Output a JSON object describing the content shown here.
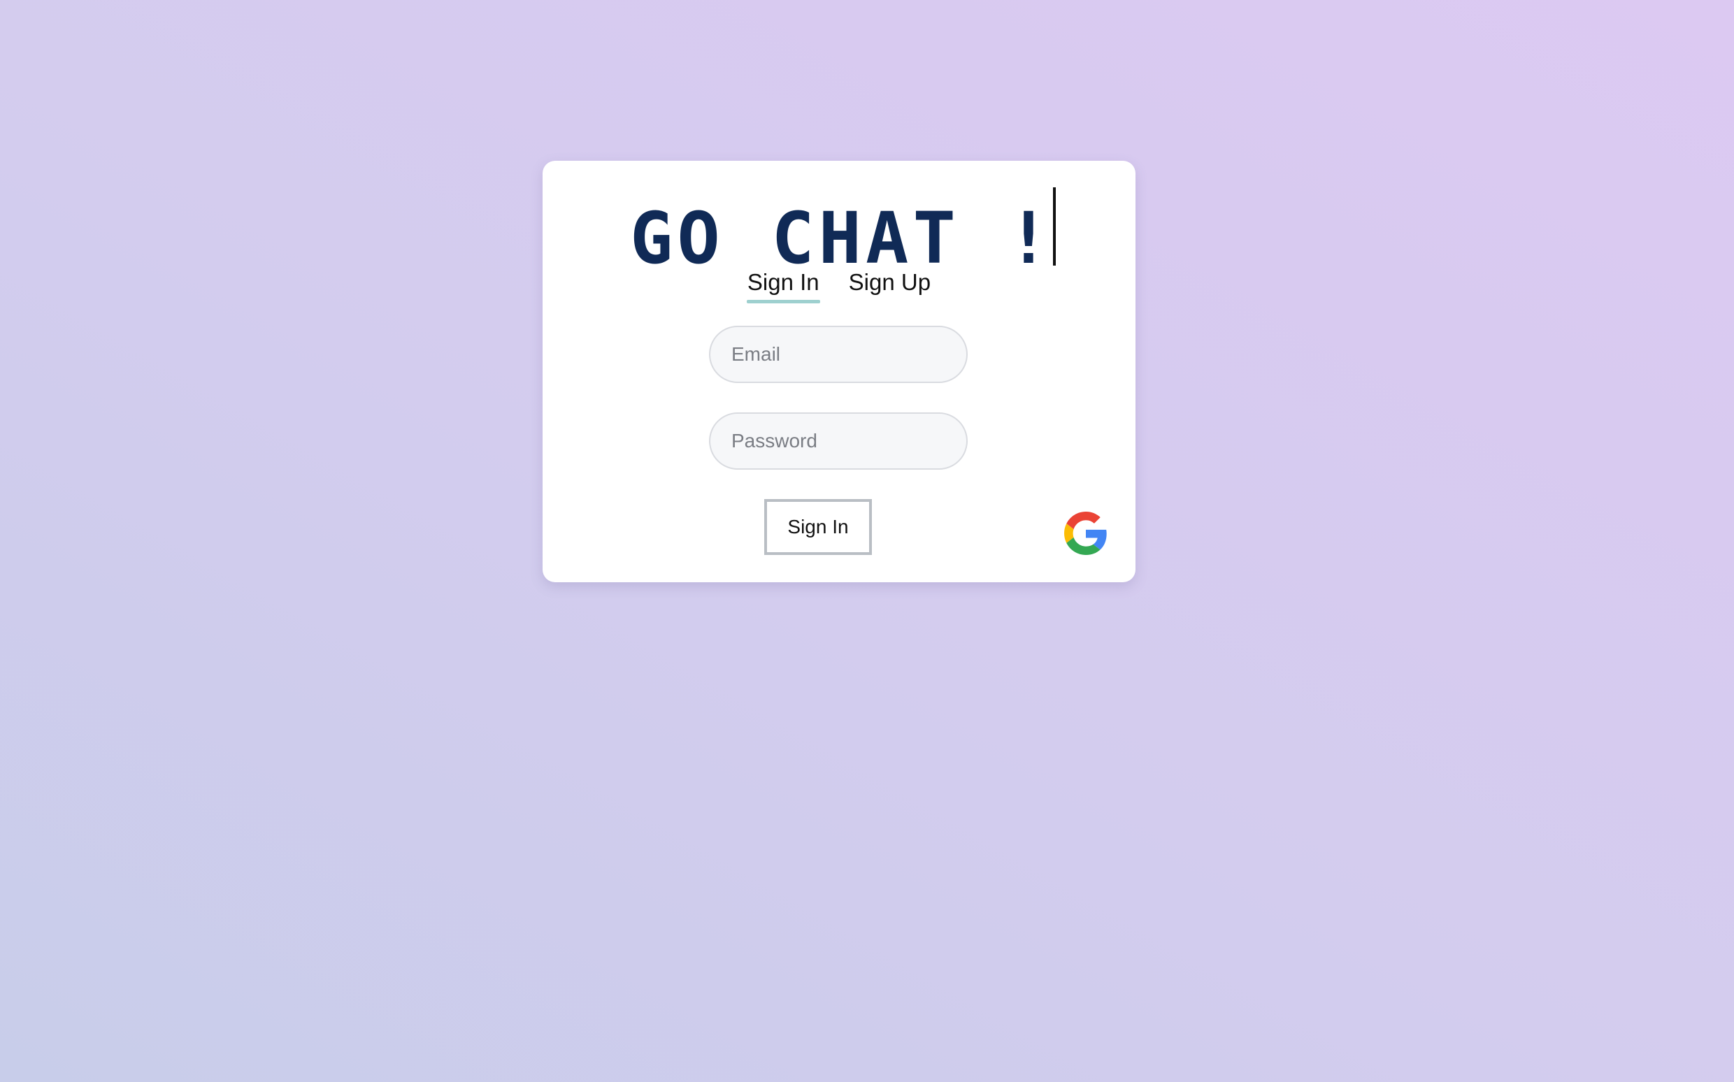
{
  "app": {
    "title": "GO CHAT !"
  },
  "tabs": [
    {
      "label": "Sign In",
      "active": true
    },
    {
      "label": "Sign Up",
      "active": false
    }
  ],
  "form": {
    "email_placeholder": "Email",
    "email_value": "",
    "password_placeholder": "Password",
    "password_value": "",
    "submit_label": "Sign In"
  },
  "oauth": {
    "provider_icon": "google-icon"
  },
  "colors": {
    "title": "#102a56",
    "active_tab_underline": "#9ed0cf",
    "background_start": "#c8cdea",
    "background_end": "#dcc9f2"
  }
}
